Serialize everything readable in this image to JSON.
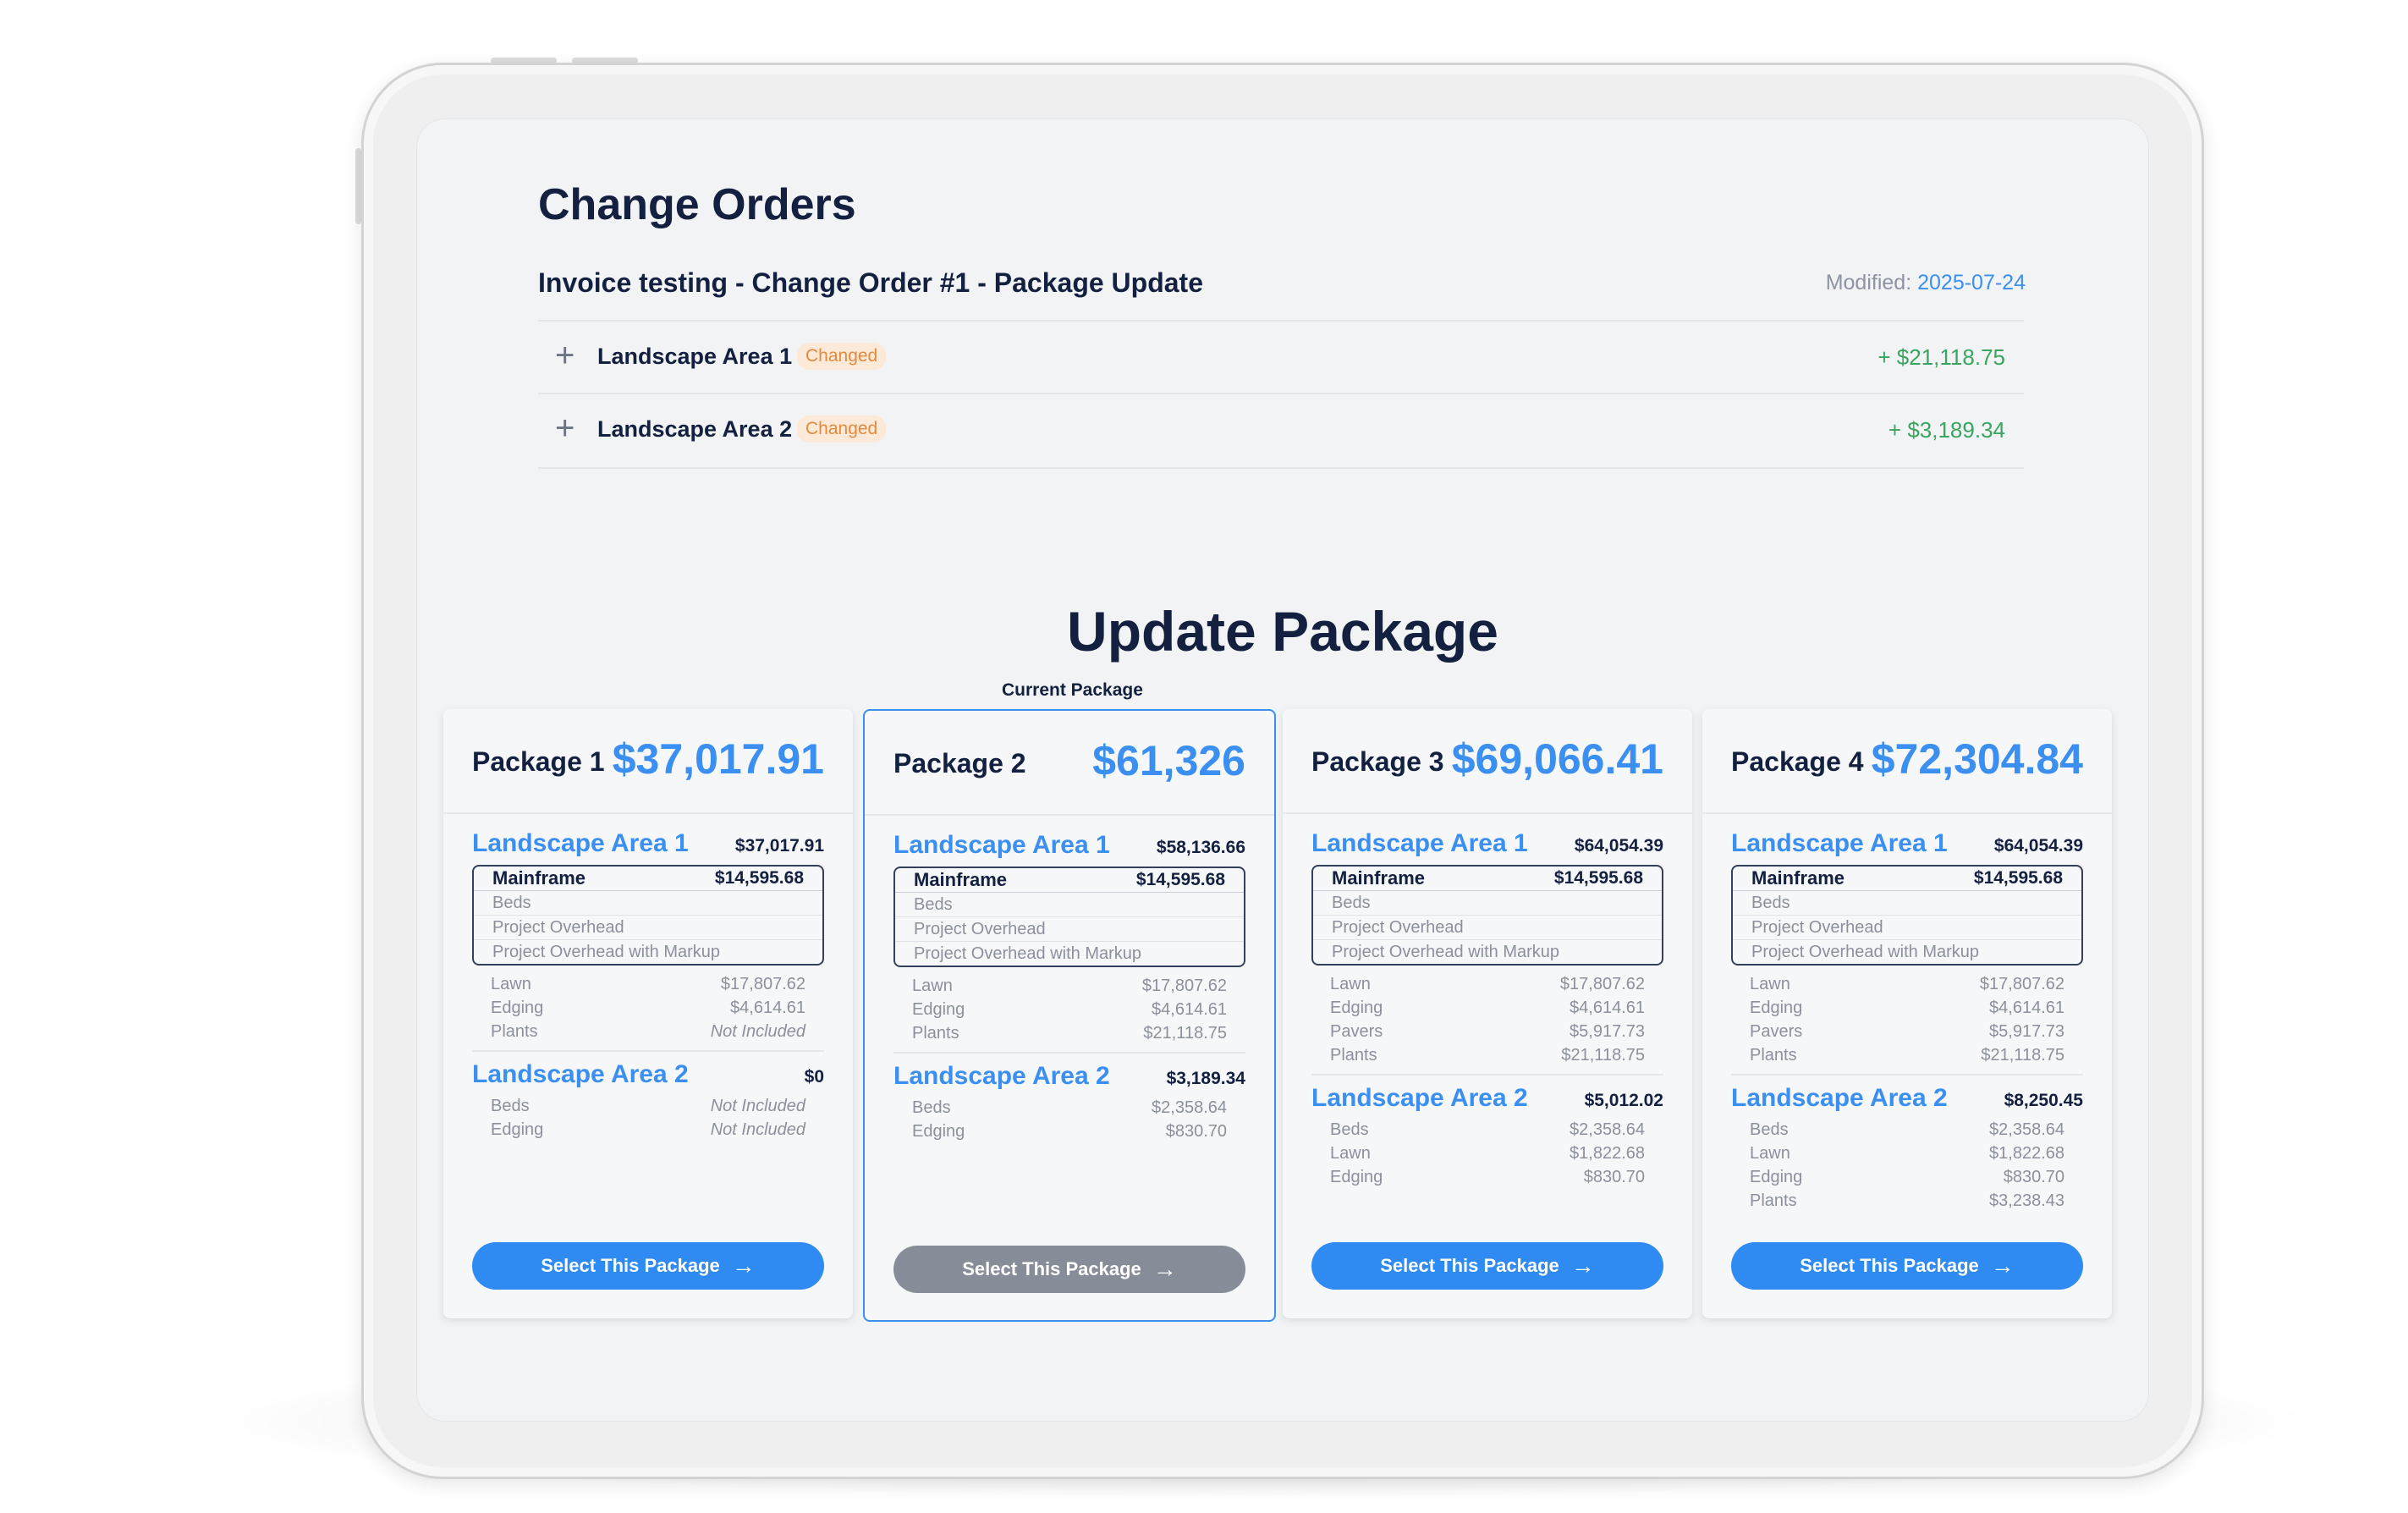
{
  "change_orders": {
    "title": "Change Orders",
    "order_title": "Invoice testing - Change Order #1 - Package Update",
    "modified_label": "Modified:",
    "modified_date": "2025-07-24",
    "rows": [
      {
        "name": "Landscape Area 1",
        "badge": "Changed",
        "amount": "+ $21,118.75"
      },
      {
        "name": "Landscape Area 2",
        "badge": "Changed",
        "amount": "+ $3,189.34"
      }
    ]
  },
  "update_package": {
    "title": "Update Package",
    "current_label": "Current Package",
    "select_label": "Select This Package",
    "packages": [
      {
        "name": "Package 1",
        "total": "$37,017.91",
        "areas": [
          {
            "name": "Landscape Area 1",
            "total": "$37,017.91",
            "mainframe": {
              "label": "Mainframe",
              "total": "$14,595.68",
              "items": [
                "Beds",
                "Project Overhead",
                "Project Overhead with Markup"
              ]
            },
            "items": [
              {
                "label": "Lawn",
                "value": "$17,807.62"
              },
              {
                "label": "Edging",
                "value": "$4,614.61"
              },
              {
                "label": "Plants",
                "value": "Not Included"
              }
            ]
          },
          {
            "name": "Landscape Area 2",
            "total": "$0",
            "items": [
              {
                "label": "Beds",
                "value": "Not Included"
              },
              {
                "label": "Edging",
                "value": "Not Included"
              }
            ]
          }
        ]
      },
      {
        "name": "Package 2",
        "total": "$61,326",
        "areas": [
          {
            "name": "Landscape Area 1",
            "total": "$58,136.66",
            "mainframe": {
              "label": "Mainframe",
              "total": "$14,595.68",
              "items": [
                "Beds",
                "Project Overhead",
                "Project Overhead with Markup"
              ]
            },
            "items": [
              {
                "label": "Lawn",
                "value": "$17,807.62"
              },
              {
                "label": "Edging",
                "value": "$4,614.61"
              },
              {
                "label": "Plants",
                "value": "$21,118.75"
              }
            ]
          },
          {
            "name": "Landscape Area 2",
            "total": "$3,189.34",
            "items": [
              {
                "label": "Beds",
                "value": "$2,358.64"
              },
              {
                "label": "Edging",
                "value": "$830.70"
              }
            ]
          }
        ]
      },
      {
        "name": "Package 3",
        "total": "$69,066.41",
        "areas": [
          {
            "name": "Landscape Area 1",
            "total": "$64,054.39",
            "mainframe": {
              "label": "Mainframe",
              "total": "$14,595.68",
              "items": [
                "Beds",
                "Project Overhead",
                "Project Overhead with Markup"
              ]
            },
            "items": [
              {
                "label": "Lawn",
                "value": "$17,807.62"
              },
              {
                "label": "Edging",
                "value": "$4,614.61"
              },
              {
                "label": "Pavers",
                "value": "$5,917.73"
              },
              {
                "label": "Plants",
                "value": "$21,118.75"
              }
            ]
          },
          {
            "name": "Landscape Area 2",
            "total": "$5,012.02",
            "items": [
              {
                "label": "Beds",
                "value": "$2,358.64"
              },
              {
                "label": "Lawn",
                "value": "$1,822.68"
              },
              {
                "label": "Edging",
                "value": "$830.70"
              }
            ]
          }
        ]
      },
      {
        "name": "Package 4",
        "total": "$72,304.84",
        "areas": [
          {
            "name": "Landscape Area 1",
            "total": "$64,054.39",
            "mainframe": {
              "label": "Mainframe",
              "total": "$14,595.68",
              "items": [
                "Beds",
                "Project Overhead",
                "Project Overhead with Markup"
              ]
            },
            "items": [
              {
                "label": "Lawn",
                "value": "$17,807.62"
              },
              {
                "label": "Edging",
                "value": "$4,614.61"
              },
              {
                "label": "Pavers",
                "value": "$5,917.73"
              },
              {
                "label": "Plants",
                "value": "$21,118.75"
              }
            ]
          },
          {
            "name": "Landscape Area 2",
            "total": "$8,250.45",
            "items": [
              {
                "label": "Beds",
                "value": "$2,358.64"
              },
              {
                "label": "Lawn",
                "value": "$1,822.68"
              },
              {
                "label": "Edging",
                "value": "$830.70"
              },
              {
                "label": "Plants",
                "value": "$3,238.43"
              }
            ]
          }
        ]
      }
    ]
  }
}
